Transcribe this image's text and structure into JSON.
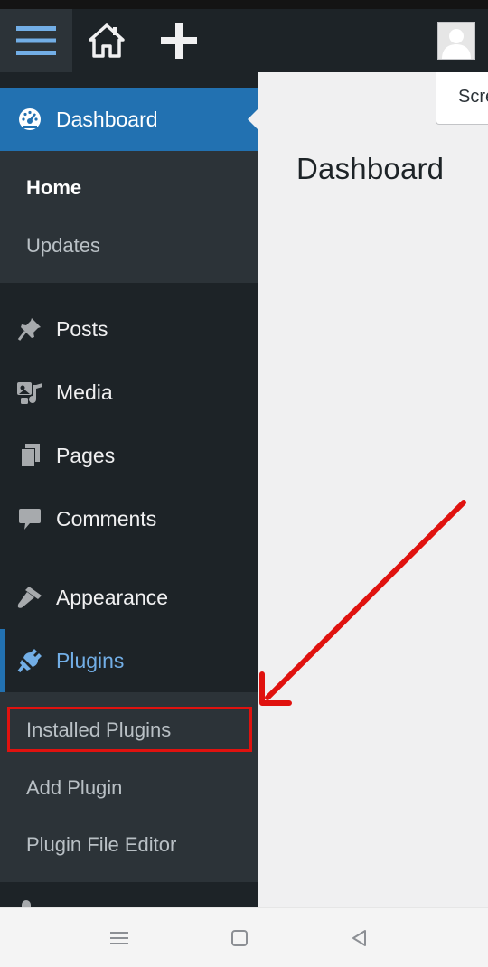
{
  "screen_options_label": "Screen Options",
  "page_title": "Dashboard",
  "menu": {
    "dashboard": "Dashboard",
    "dashboard_sub": [
      "Home",
      "Updates"
    ],
    "posts": "Posts",
    "media": "Media",
    "pages": "Pages",
    "comments": "Comments",
    "appearance": "Appearance",
    "plugins": "Plugins",
    "plugins_sub": [
      "Installed Plugins",
      "Add Plugin",
      "Plugin File Editor"
    ]
  },
  "colors": {
    "admin_bar": "#1d2327",
    "current_item": "#2271b1",
    "open_item_text": "#72aee6",
    "annotation": "#e0120f"
  },
  "icons": {
    "hamburger": "menu-icon",
    "home": "home-icon",
    "new": "plus-icon",
    "avatar": "avatar",
    "dashboard": "dashboard-icon",
    "posts": "pin-icon",
    "media": "media-icon",
    "pages": "pages-icon",
    "comments": "comment-icon",
    "appearance": "brush-icon",
    "plugins": "plug-icon"
  }
}
